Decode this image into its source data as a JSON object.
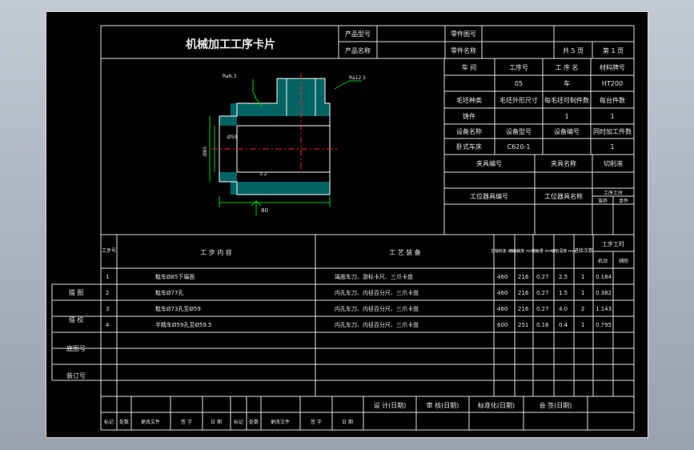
{
  "card_title": "机械加工工序卡片",
  "header": {
    "product_model_label": "产品型号",
    "product_name_label": "产品名称",
    "part_drawing_no_label": "零件图号",
    "part_name_label": "零件名称",
    "total_pages": "共 5 页",
    "page_no": "第 1 页"
  },
  "info": {
    "workshop_label": "车 间",
    "process_no_label": "工序号",
    "process_name_label": "工 序 名",
    "material_label": "材料牌号",
    "process_no": "05",
    "process_name": "车",
    "material": "HT200",
    "blank_type_label": "毛坯种类",
    "blank_size_label": "毛坯外形尺寸",
    "blanks_per_label": "每毛坯可制件数",
    "parts_per_label": "每台件数",
    "blank_type": "铸件",
    "blanks_per": "1",
    "parts_per": "1",
    "equip_name_label": "设备名称",
    "equip_model_label": "设备型号",
    "equip_no_label": "设备编号",
    "simul_label": "同时加工件数",
    "equip_name": "卧式车床",
    "equip_model": "C620-1",
    "simul": "1",
    "fixture_no_label": "夹具编号",
    "fixture_name_label": "夹具名称",
    "coolant_label": "切削液",
    "station_tool_no_label": "工位器具编号",
    "station_tool_name_label": "工位器具名称",
    "step_hours_label": "工序工时",
    "quasi_label": "准终",
    "unit_label": "单件"
  },
  "steps_table": {
    "col_step_no": "工步号",
    "col_content": "工 步 内 容",
    "col_equipment": "工 艺 装 备",
    "col_speed": "主轴转速 r/min",
    "col_cut_speed": "切削速度 m/min",
    "col_feed": "进给量 mm/r",
    "col_depth": "切削深度 mm",
    "col_passes": "进给次数",
    "col_hours": "工步工时",
    "col_machine": "机动",
    "col_aux": "辅助",
    "rows": [
      {
        "no": "1",
        "content": "粗车Ø85下端面",
        "equip": "端面车刀、游标卡尺、三爪卡盘",
        "speed": "460",
        "v": "216",
        "f": "0.27",
        "ap": "2.5",
        "n": "1",
        "t": "0.184"
      },
      {
        "no": "2",
        "content": "粗车Ø77孔",
        "equip": "内孔车刀、内径百分尺、三爪卡盘",
        "speed": "460",
        "v": "216",
        "f": "0.27",
        "ap": "1.5",
        "n": "1",
        "t": "0.382"
      },
      {
        "no": "3",
        "content": "粗车Ø73孔至Ø59",
        "equip": "内孔车刀、内径百分尺、三爪卡盘",
        "speed": "460",
        "v": "216",
        "f": "0.27",
        "ap": "4.0",
        "n": "2",
        "t": "1.143"
      },
      {
        "no": "4",
        "content": "半精车Ø59孔至Ø59.5",
        "equip": "内孔车刀、内径百分尺、三爪卡盘",
        "speed": "600",
        "v": "251",
        "f": "0.16",
        "ap": "0.4",
        "n": "1",
        "t": "0.795"
      }
    ]
  },
  "side_labels": [
    "描 图",
    "描 校",
    "底图号",
    "装订号"
  ],
  "signatures": {
    "design": "设 计(日期)",
    "review": "审 核(日期)",
    "standard": "标准化(日期)",
    "countersign": "会 签(日期)"
  },
  "revision_cols": [
    "标记",
    "处数",
    "更改文件",
    "签 字",
    "日 期",
    "标记",
    "处数",
    "更改文件",
    "签 字",
    "日 期"
  ],
  "drawing": {
    "dim_A": "80",
    "dim_B": "Ø59",
    "dim_C": "Ø85",
    "roughness_1": "Ra6.3",
    "roughness_2": "Ra12.5",
    "roughness_3": "3.2"
  },
  "colors": {
    "background": "#a9b1bd",
    "sheet": "#000000",
    "lines": "#ffffff",
    "hatch": "#00cccc",
    "dimension": "#00d000",
    "centerline": "#ff2020"
  }
}
